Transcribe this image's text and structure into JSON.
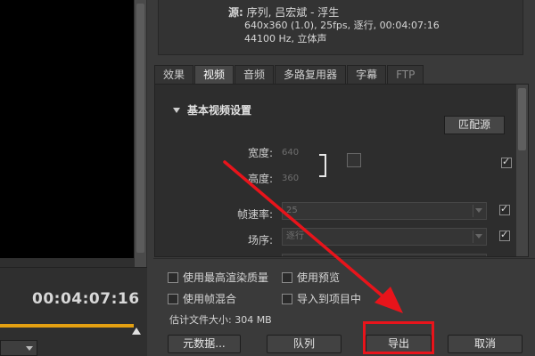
{
  "summary": {
    "source_label": "源:",
    "source_value": "序列, 吕宏斌 - 浮生",
    "video_info": "640x360 (1.0), 25fps, 逐行, 00:04:07:16",
    "audio_info": "44100 Hz, 立体声"
  },
  "tabs": [
    {
      "label": "效果"
    },
    {
      "label": "视频"
    },
    {
      "label": "音频"
    },
    {
      "label": "多路复用器"
    },
    {
      "label": "字幕"
    },
    {
      "label": "FTP"
    }
  ],
  "video_settings": {
    "section_title": "基本视频设置",
    "match_source_label": "匹配源",
    "width_label": "宽度:",
    "width_value": "640",
    "height_label": "高度:",
    "height_value": "360",
    "frame_rate_label": "帧速率:",
    "frame_rate_value": "25",
    "field_order_label": "场序:",
    "field_order_value": "逐行"
  },
  "options": {
    "max_render_quality": "使用最高渲染质量",
    "use_preview": "使用预览",
    "frame_blending": "使用帧混合",
    "import_into_project": "导入到项目中",
    "estimated_size": "估计文件大小: 304 MB"
  },
  "buttons": {
    "metadata": "元数据...",
    "queue": "队列",
    "export": "导出",
    "cancel": "取消"
  },
  "player": {
    "timecode": "00:04:07:16"
  },
  "colors": {
    "timeline_accent": "#e3a012",
    "highlight": "#e8141b"
  }
}
